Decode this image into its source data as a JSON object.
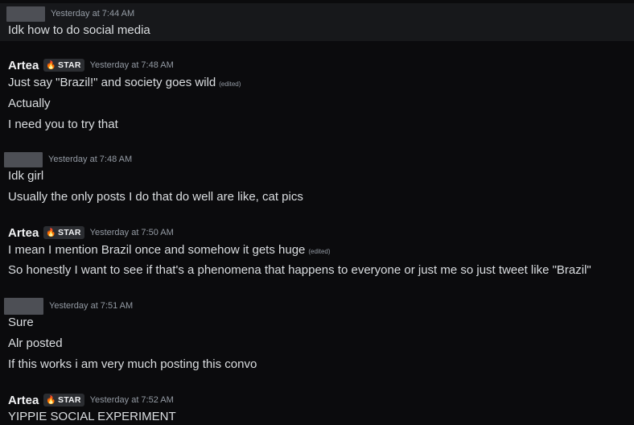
{
  "messages": [
    {
      "author": "",
      "redacted": true,
      "timestamp": "Yesterday at 7:44 AM",
      "lines": [
        {
          "text": "Idk how to do social media"
        }
      ]
    },
    {
      "author": "Artea",
      "badge": "STAR",
      "badge_icon": "flame-icon",
      "timestamp": "Yesterday at 7:48 AM",
      "lines": [
        {
          "text": "Just say \"Brazil!\" and society goes wild",
          "edited": "(edited)"
        },
        {
          "text": "Actually"
        },
        {
          "text": "I need you to try that"
        }
      ]
    },
    {
      "author": "",
      "redacted": true,
      "timestamp": "Yesterday at 7:48 AM",
      "lines": [
        {
          "text": "Idk girl"
        },
        {
          "text": "Usually the only posts I do that do well are like, cat pics"
        }
      ]
    },
    {
      "author": "Artea",
      "badge": "STAR",
      "badge_icon": "flame-icon",
      "timestamp": "Yesterday at 7:50 AM",
      "lines": [
        {
          "text": "I mean I mention Brazil once and somehow it gets huge",
          "edited": "(edited)"
        },
        {
          "text": "So honestly I want to see if that's a phenomena that happens to everyone or just me so just tweet like \"Brazil\""
        }
      ]
    },
    {
      "author": "",
      "redacted": true,
      "timestamp": "Yesterday at 7:51 AM",
      "lines": [
        {
          "text": "Sure"
        },
        {
          "text": "Alr posted"
        },
        {
          "text": "If this works i am very much posting this convo"
        }
      ]
    },
    {
      "author": "Artea",
      "badge": "STAR",
      "badge_icon": "flame-icon",
      "timestamp": "Yesterday at 7:52 AM",
      "lines": [
        {
          "text": "YIPPIE SOCIAL EXPERIMENT"
        }
      ]
    }
  ],
  "colors": {
    "background": "#0b0b0d",
    "highlight_row": "#17181b",
    "text": "#dbdee1",
    "author": "#f2f3f5",
    "timestamp": "#949ba4",
    "badge_bg": "#2b2d31",
    "redacted": "#4d4f55"
  }
}
